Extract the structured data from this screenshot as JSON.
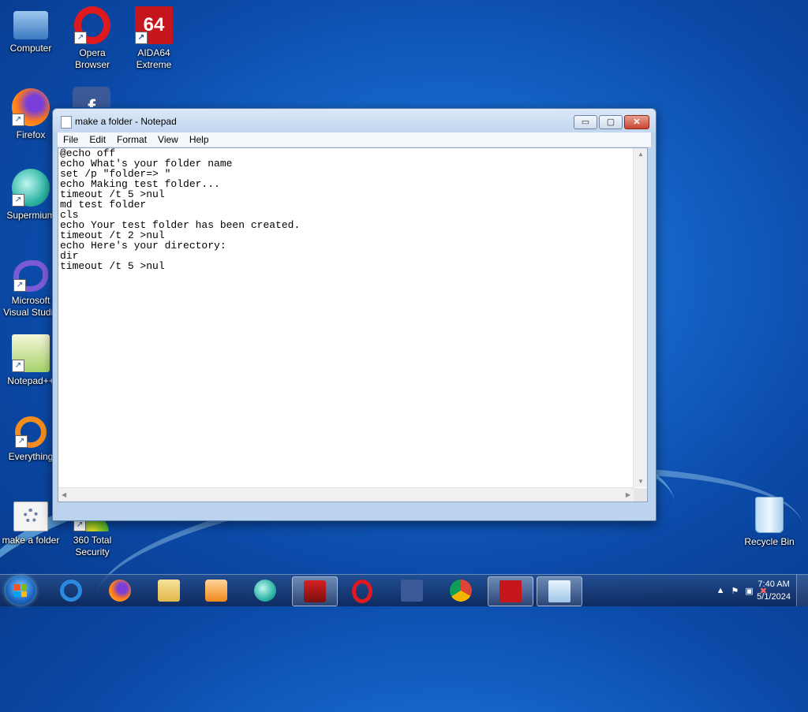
{
  "desktop": {
    "icons": [
      {
        "label": "Computer",
        "icon": "computer-icon"
      },
      {
        "label": "Opera\nBrowser",
        "icon": "opera-icon"
      },
      {
        "label": "AIDA64\nExtreme",
        "icon": "aida64-icon"
      },
      {
        "label": "Firefox",
        "icon": "firefox-icon"
      },
      {
        "label": "Supermium",
        "icon": "supermium-icon"
      },
      {
        "label": "Microsoft\nVisual Studio",
        "icon": "visual-studio-icon"
      },
      {
        "label": "Notepad++",
        "icon": "notepadpp-icon"
      },
      {
        "label": "Everything",
        "icon": "everything-icon"
      },
      {
        "label": "make a folder",
        "icon": "batch-file-icon"
      },
      {
        "label": "360 Total\nSecurity",
        "icon": "360-security-icon"
      },
      {
        "label": "Recycle Bin",
        "icon": "recycle-bin-icon"
      }
    ]
  },
  "notepad": {
    "title": "make a folder - Notepad",
    "menu": [
      "File",
      "Edit",
      "Format",
      "View",
      "Help"
    ],
    "content": "@echo off\necho What's your folder name\nset /p \"folder=> \"\necho Making test folder...\ntimeout /t 5 >nul\nmd test folder\ncls\necho Your test folder has been created.\ntimeout /t 2 >nul\necho Here's your directory:\ndir\ntimeout /t 5 >nul",
    "buttons": {
      "minimize": "▭",
      "maximize": "▢",
      "close": "✕"
    }
  },
  "taskbar": {
    "pinned": [
      "internet-explorer-icon",
      "firefox-icon",
      "file-explorer-icon",
      "media-player-icon",
      "supermium-icon",
      "game-icon",
      "opera-icon",
      "facebook-icon",
      "chrome-icon",
      "aida64-icon",
      "notepad-icon"
    ],
    "clock_time": "7:40 AM",
    "clock_date": "5/1/2024"
  },
  "colors": {
    "accent": "#1565c8",
    "close": "#c9452f"
  }
}
